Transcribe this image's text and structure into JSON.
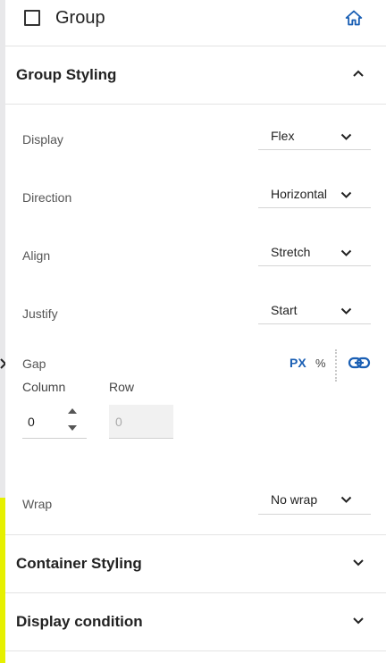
{
  "header": {
    "title": "Group",
    "home_icon": "home-icon",
    "checkbox_checked": false
  },
  "sections": {
    "group_styling": {
      "title": "Group Styling",
      "expanded": true
    },
    "container_styling": {
      "title": "Container Styling",
      "expanded": false
    },
    "display_condition": {
      "title": "Display condition",
      "expanded": false
    }
  },
  "fields": {
    "display": {
      "label": "Display",
      "value": "Flex"
    },
    "direction": {
      "label": "Direction",
      "value": "Horizontal"
    },
    "align": {
      "label": "Align",
      "value": "Stretch"
    },
    "justify": {
      "label": "Justify",
      "value": "Start"
    },
    "wrap": {
      "label": "Wrap",
      "value": "No wrap"
    }
  },
  "gap": {
    "label": "Gap",
    "unit_px": "PX",
    "unit_percent": "%",
    "active_unit": "PX",
    "link_icon": "link-icon",
    "column_label": "Column",
    "column_value": "0",
    "row_label": "Row",
    "row_value": "0"
  },
  "colors": {
    "accent": "#1a5fb4",
    "highlight": "#e6f000"
  }
}
